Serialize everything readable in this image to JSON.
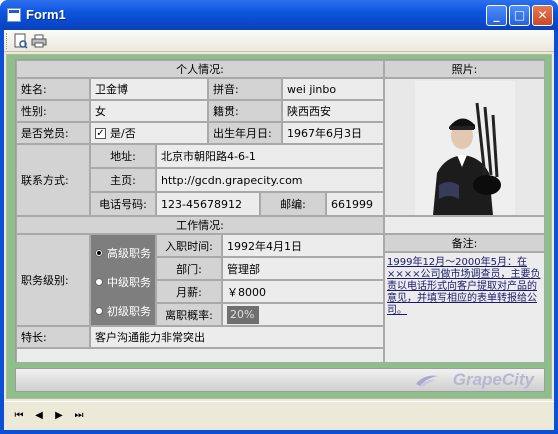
{
  "window": {
    "title": "Form1"
  },
  "controls": {
    "minimize": "_",
    "maximize": "□",
    "close": "✕"
  },
  "toolbar": {
    "icons": [
      "page-setup-icon",
      "print-icon"
    ]
  },
  "sections": {
    "personal": "个人情况:",
    "photo": "照片:",
    "work": "工作情况:",
    "remark": "备注:"
  },
  "personal": {
    "name_label": "姓名:",
    "name_value": "卫金博",
    "pinyin_label": "拼音:",
    "pinyin_value": "wei jinbo",
    "gender_label": "性别:",
    "gender_value": "女",
    "origin_label": "籍贯:",
    "origin_value": "陕西西安",
    "party_label": "是否党员:",
    "party_option": "是/否",
    "party_checked": true,
    "birth_label": "出生年月日:",
    "birth_value": "1967年6月3日",
    "contact_label": "联系方式:",
    "address_label": "地址:",
    "address_value": "北京市朝阳路4-6-1",
    "homepage_label": "主页:",
    "homepage_value": "http://gcdn.grapecity.com",
    "phone_label": "电话号码:",
    "phone_value": "123-45678912",
    "postcode_label": "邮编:",
    "postcode_value": "661999"
  },
  "work": {
    "level_label": "职务级别:",
    "levels": [
      "高级职务",
      "中级职务",
      "初级职务"
    ],
    "selected_level": "高级职务",
    "start_label": "入职时间:",
    "start_value": "1992年4月1日",
    "dept_label": "部门:",
    "dept_value": "管理部",
    "salary_label": "月薪:",
    "salary_value": "￥8000",
    "turnover_label": "离职概率:",
    "turnover_value": "20%",
    "remark_text": "1999年12月～2000年5月：在××××公司做市场调查员，主要负责以电话形式向客户提取对产品的意见，并填写相应的表单转报给公司。",
    "specialty_label": "特长:",
    "specialty_value": "客户沟通能力非常突出"
  },
  "brand": "GrapeCity",
  "navigation": {
    "first": "⏮",
    "prev": "◀",
    "next": "▶",
    "last": "⏭"
  },
  "colors": {
    "titlebar": "#0a55de",
    "form_bg": "#8cbf8a",
    "label_bg": "#d3d3d3",
    "value_bg": "#ececec"
  }
}
